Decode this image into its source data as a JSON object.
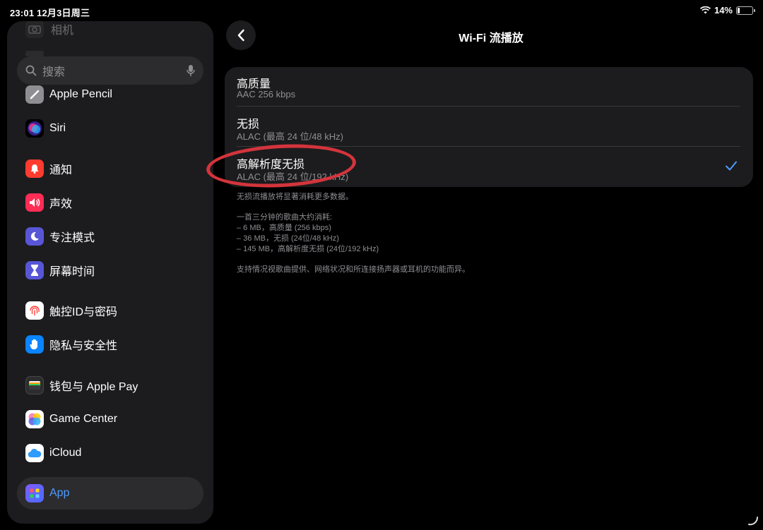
{
  "status_bar": {
    "time_date": "23:01   12月3日周三",
    "battery": "14%",
    "battery_level": 0.14
  },
  "sidebar": {
    "faded_top_label": "相机",
    "search_placeholder": "搜索",
    "items": [
      {
        "label": "Apple Pencil",
        "icon": "pencil-icon",
        "color": "#8e8e93"
      },
      {
        "label": "Siri",
        "icon": "siri-icon",
        "color": "#5b2bd6"
      },
      {
        "label": "通知",
        "icon": "bell-icon",
        "color": "#ff3b30"
      },
      {
        "label": "声效",
        "icon": "speaker-icon",
        "color": "#ff2d55"
      },
      {
        "label": "专注模式",
        "icon": "moon-icon",
        "color": "#5856d6"
      },
      {
        "label": "屏幕时间",
        "icon": "hourglass-icon",
        "color": "#5856d6"
      },
      {
        "label": "触控ID与密码",
        "icon": "fingerprint-icon",
        "color": "#ffffff"
      },
      {
        "label": "隐私与安全性",
        "icon": "hand-icon",
        "color": "#0a84ff"
      },
      {
        "label": "钱包与 Apple Pay",
        "icon": "wallet-icon",
        "color": "#2c2c2e"
      },
      {
        "label": "Game Center",
        "icon": "game-center-icon",
        "color": "#ffffff"
      },
      {
        "label": "iCloud",
        "icon": "cloud-icon",
        "color": "#ffffff"
      },
      {
        "label": "App",
        "icon": "app-grid-icon",
        "color": "#5e5ce6",
        "selected": true
      }
    ]
  },
  "detail": {
    "title": "Wi-Fi 流播放",
    "options": [
      {
        "title": "高质量",
        "subtitle": "AAC 256 kbps",
        "checked": false
      },
      {
        "title": "无损",
        "subtitle": "ALAC (最高 24 位/48 kHz)",
        "checked": false
      },
      {
        "title": "高解析度无损",
        "subtitle": "ALAC (最高 24 位/192 kHz)",
        "checked": true
      }
    ],
    "footer": {
      "line1": "无损流播放将显著消耗更多数据。",
      "line2": "一首三分钟的歌曲大约消耗:",
      "line3": "– 6 MB，高质量 (256 kbps)",
      "line4": "– 36 MB，无损 (24位/48 kHz)",
      "line5": "– 145 MB，高解析度无损 (24位/192 kHz)",
      "line6": "支持情况视歌曲提供、网络状况和所连接扬声器或耳机的功能而异。"
    }
  },
  "colors": {
    "accent": "#4e9bff",
    "annotation": "#d4343c"
  }
}
